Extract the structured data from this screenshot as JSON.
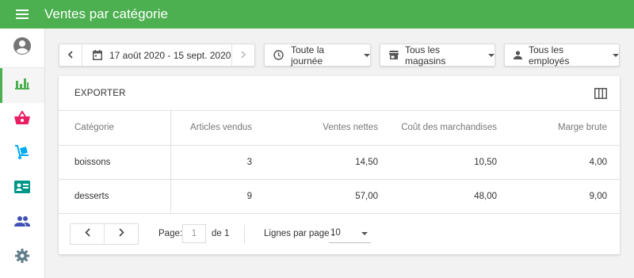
{
  "app": {
    "title": "Ventes par catégorie",
    "accent": "#4caf50"
  },
  "sidebar": {
    "items": [
      {
        "name": "account",
        "icon": "account-circle-icon",
        "color": "#757575"
      },
      {
        "name": "reports",
        "icon": "bar-chart-icon",
        "color": "#4caf50",
        "active": true
      },
      {
        "name": "sales",
        "icon": "shopping-basket-icon",
        "color": "#e91e63"
      },
      {
        "name": "items",
        "icon": "dolly-icon",
        "color": "#03a9f4"
      },
      {
        "name": "employees",
        "icon": "badge-icon",
        "color": "#009688"
      },
      {
        "name": "customers",
        "icon": "people-icon",
        "color": "#3f51b5"
      },
      {
        "name": "settings",
        "icon": "gear-icon",
        "color": "#607d8b"
      }
    ]
  },
  "filters": {
    "date_range": "17 août 2020 - 15 sept. 2020",
    "time": "Toute la journée",
    "stores": "Tous les magasins",
    "employees": "Tous les employés"
  },
  "card": {
    "export_label": "EXPORTER",
    "columns": [
      "Catégorie",
      "Articles vendus",
      "Ventes nettes",
      "Coût des marchandises",
      "Marge brute"
    ],
    "rows": [
      [
        "boissons",
        "3",
        "14,50",
        "10,50",
        "4,00"
      ],
      [
        "desserts",
        "9",
        "57,00",
        "48,00",
        "9,00"
      ]
    ]
  },
  "pagination": {
    "page_label": "Page:",
    "page_value": "1",
    "of_label": "de 1",
    "rows_per_page_label": "Lignes par page :",
    "rows_per_page_value": "10"
  }
}
